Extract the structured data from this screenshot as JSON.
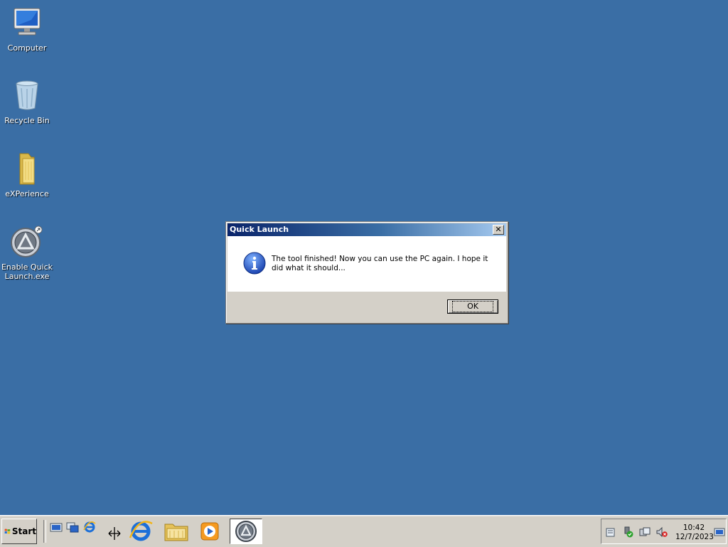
{
  "desktop": {
    "background": "#3a6ea5",
    "icons": [
      {
        "label": "Computer",
        "icon": "computer-icon"
      },
      {
        "label": "Recycle Bin",
        "icon": "recycle-bin-icon"
      },
      {
        "label": "eXPerience",
        "icon": "folder-icon"
      },
      {
        "label": "Enable Quick\nLaunch.exe",
        "icon": "app-icon"
      }
    ]
  },
  "dialog": {
    "title": "Quick Launch",
    "message": "The tool finished! Now you can use the PC again. I hope it did what it should...",
    "ok_label": "OK",
    "close_symbol": "✕",
    "icon": "info-icon"
  },
  "taskbar": {
    "start_label": "Start",
    "quick_launch": [
      "show-desktop-icon",
      "switch-windows-icon",
      "internet-explorer-icon"
    ],
    "pinned": [
      "internet-explorer-icon",
      "file-explorer-icon",
      "media-player-icon"
    ],
    "active_task": "quick-launch-app-icon",
    "tray": [
      "action-center-icon",
      "network-icon",
      "power-icon",
      "volume-muted-icon"
    ],
    "clock": {
      "time": "10:42",
      "date": "12/7/2023"
    }
  }
}
